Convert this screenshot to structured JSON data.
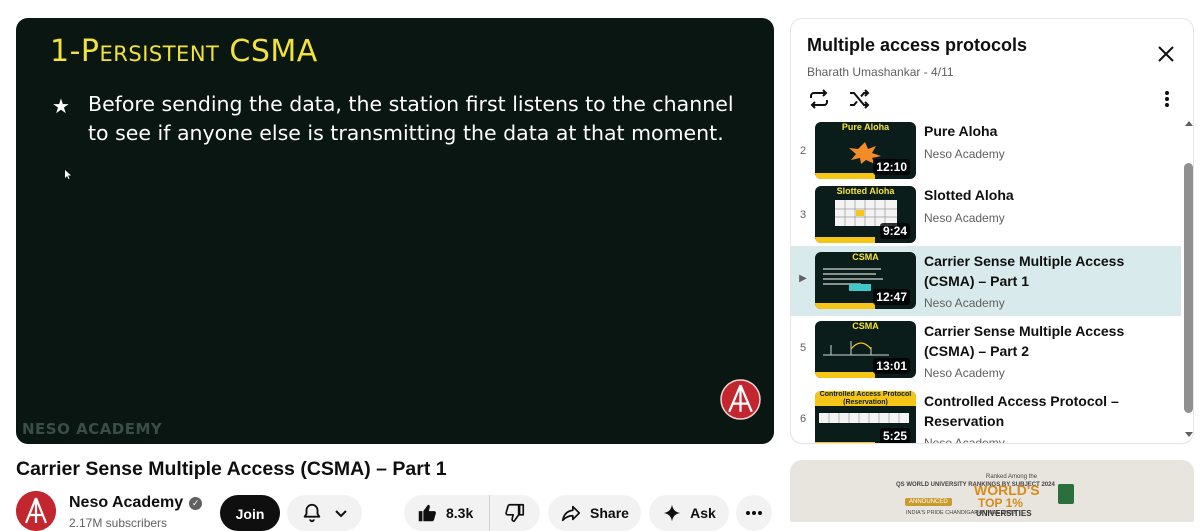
{
  "player": {
    "slide_title": "1-Persistent CSMA",
    "bullet": "★",
    "bullet_text": "Before sending the data, the station first listens to the channel to see if anyone else is transmitting the data at that moment.",
    "watermark": "NESO ACADEMY",
    "accent": "#f2e23a",
    "background": "#0a1612"
  },
  "video": {
    "title": "Carrier Sense Multiple Access (CSMA) – Part 1",
    "channel_name": "Neso Academy",
    "subscribers": "2.17M subscribers",
    "join_label": "Join",
    "likes": "8.3k",
    "share_label": "Share",
    "ask_label": "Ask"
  },
  "playlist": {
    "title": "Multiple access protocols",
    "subtitle": "Bharath Umashankar - 4/11",
    "items": [
      {
        "index": "2",
        "title": "Pure Aloha",
        "channel": "Neso Academy",
        "duration": "12:10",
        "thumb_label": "Pure Aloha",
        "active": false
      },
      {
        "index": "3",
        "title": "Slotted Aloha",
        "channel": "Neso Academy",
        "duration": "9:24",
        "thumb_label": "Slotted Aloha",
        "active": false
      },
      {
        "index": "▶",
        "title": "Carrier Sense Multiple Access (CSMA) – Part 1",
        "channel": "Neso Academy",
        "duration": "12:47",
        "thumb_label": "CSMA",
        "active": true
      },
      {
        "index": "5",
        "title": "Carrier Sense Multiple Access (CSMA) – Part 2",
        "channel": "Neso Academy",
        "duration": "13:01",
        "thumb_label": "CSMA",
        "active": false
      },
      {
        "index": "6",
        "title": "Controlled Access Protocol – Reservation",
        "channel": "Neso Academy",
        "duration": "5:25",
        "thumb_label": "Controlled Access Protocol (Reservation)",
        "active": false
      }
    ]
  },
  "ad": {
    "line1": "QS WORLD UNIVERSITY RANKINGS BY SUBJECT 2024",
    "tag": "ANNOUNCED",
    "line2": "INDIA'S PRIDE CHANDIGARH UNIVERSITY",
    "rank_prefix": "Ranked Among the",
    "world": "WORLD'S",
    "top": "TOP 1%",
    "universities": "UNIVERSITIES"
  }
}
